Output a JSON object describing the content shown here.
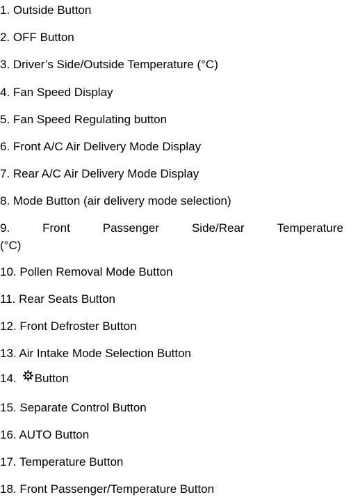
{
  "items": [
    "1. Outside Button",
    "2. OFF Button",
    "3. Driver’s Side/Outside Temperature (°C)",
    "4. Fan Speed Display",
    "5. Fan Speed Regulating button",
    "6. Front A/C Air Delivery Mode Display",
    "7. Rear A/C Air Delivery Mode Display",
    "8. Mode Button (air delivery mode selection)",
    "9. Front Passenger Side/Rear Temperature (°C)",
    "10. Pollen Removal Mode Button",
    "11. Rear Seats Button",
    "12. Front Defroster Button",
    "13. Air Intake Mode Selection Button",
    "14. Button",
    "15. Separate Control Button",
    "16. AUTO Button",
    "17. Temperature Button",
    "18. Front Passenger/Temperature Button"
  ],
  "item9_words": [
    "9.",
    "Front",
    "Passenger",
    "Side/Rear",
    "Temperature"
  ],
  "item9_wrap": "(°C)",
  "item14_number": "14.",
  "item14_icon": "fan-icon",
  "item14_label": "Button"
}
